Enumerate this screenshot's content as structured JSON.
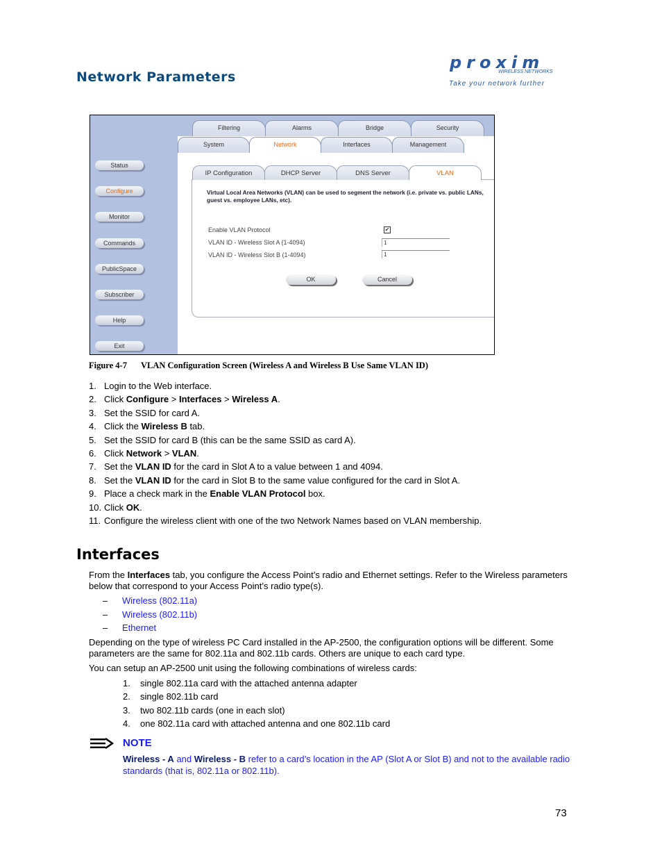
{
  "header": {
    "title": "Network Parameters",
    "logo_text": "proxim",
    "logo_sub": "WIRELESS NETWORKS",
    "logo_tagline": "Take your network further"
  },
  "screenshot": {
    "sidebar": [
      {
        "label": "Status"
      },
      {
        "label": "Configure",
        "active": true
      },
      {
        "label": "Monitor"
      },
      {
        "label": "Commands"
      },
      {
        "label": "PublicSpace"
      },
      {
        "label": "Subscriber"
      },
      {
        "label": "Help"
      },
      {
        "label": "Exit"
      }
    ],
    "tabs_row1": [
      "Filtering",
      "Alarms",
      "Bridge",
      "Security"
    ],
    "tabs_row2": [
      "System",
      "Network",
      "Interfaces",
      "Management"
    ],
    "active_tab": "Network",
    "subtabs": [
      "IP Configuration",
      "DHCP Server",
      "DNS Server",
      "VLAN"
    ],
    "active_subtab": "VLAN",
    "description": "Virtual Local Area Networks (VLAN) can be used to segment the network (i.e. private vs. public LANs, guest vs. employee LANs, etc).",
    "enable_label": "Enable VLAN Protocol",
    "enable_checked": true,
    "slot_a_label": "VLAN ID - Wireless Slot A (1-4094)",
    "slot_a_value": "1",
    "slot_b_label": "VLAN ID - Wireless Slot B (1-4094)",
    "slot_b_value": "1",
    "ok_label": "OK",
    "cancel_label": "Cancel",
    "accent_color": "#e06a18"
  },
  "caption": {
    "number": "Figure 4-7",
    "text": "VLAN Configuration Screen (Wireless A and Wireless B Use Same VLAN ID)"
  },
  "steps": [
    [
      {
        "t": "Login to the Web interface."
      }
    ],
    [
      {
        "t": "Click "
      },
      {
        "t": "Configure",
        "b": true
      },
      {
        "t": " > "
      },
      {
        "t": "Interfaces",
        "b": true
      },
      {
        "t": " > "
      },
      {
        "t": "Wireless A",
        "b": true
      },
      {
        "t": "."
      }
    ],
    [
      {
        "t": "Set the SSID for card A."
      }
    ],
    [
      {
        "t": "Click the "
      },
      {
        "t": "Wireless B",
        "b": true
      },
      {
        "t": " tab."
      }
    ],
    [
      {
        "t": "Set the SSID for card B (this can be the same SSID as card A)."
      }
    ],
    [
      {
        "t": "Click "
      },
      {
        "t": "Network",
        "b": true
      },
      {
        "t": " > "
      },
      {
        "t": "VLAN",
        "b": true
      },
      {
        "t": "."
      }
    ],
    [
      {
        "t": "Set the "
      },
      {
        "t": "VLAN ID",
        "b": true
      },
      {
        "t": " for the card in Slot A to a value between 1 and 4094."
      }
    ],
    [
      {
        "t": "Set the "
      },
      {
        "t": "VLAN ID",
        "b": true
      },
      {
        "t": " for the card in Slot B to the same value configured for the card in Slot A."
      }
    ],
    [
      {
        "t": "Place a check mark in the "
      },
      {
        "t": "Enable VLAN Protocol",
        "b": true
      },
      {
        "t": " box."
      }
    ],
    [
      {
        "t": "Click "
      },
      {
        "t": "OK",
        "b": true
      },
      {
        "t": "."
      }
    ],
    [
      {
        "t": "Configure the wireless client with one of the two Network Names based on VLAN membership."
      }
    ]
  ],
  "interfaces": {
    "heading": "Interfaces",
    "intro": [
      {
        "t": "From the "
      },
      {
        "t": "Interfaces",
        "b": true
      },
      {
        "t": " tab, you configure the Access Point’s radio and Ethernet settings. Refer to the Wireless parameters below that correspond to your Access Point’s radio type(s)."
      }
    ],
    "links": [
      "Wireless (802.11a)",
      "Wireless (802.11b)",
      "Ethernet"
    ],
    "para2": "Depending on the type of wireless PC Card installed in the AP-2500, the configuration options will be different. Some parameters are the same for 802.11a and 802.11b cards. Others are unique to each card type.",
    "para3": "You can setup an AP-2500 unit using the following combinations of wireless cards:",
    "combos": [
      "single 802.11a card with the attached antenna adapter",
      "single 802.11b card",
      "two 802.11b cards (one in each slot)",
      "one 802.11a card with attached antenna and one 802.11b card"
    ]
  },
  "note": {
    "icon": "arrow-right-icon",
    "title": "NOTE",
    "body": [
      {
        "t": "Wireless - A",
        "b": true
      },
      {
        "t": " and "
      },
      {
        "t": "Wireless - B",
        "b": true
      },
      {
        "t": " refer to a card’s location in the AP (Slot A or Slot B) and not to the available radio standards (that is, 802.11a or 802.11b)."
      }
    ]
  },
  "page_number": "73"
}
